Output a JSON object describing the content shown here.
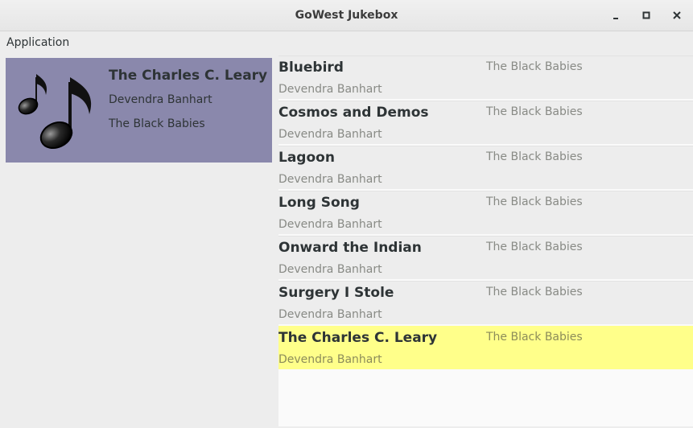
{
  "window": {
    "title": "GoWest Jukebox"
  },
  "menu": {
    "items": [
      "Application"
    ]
  },
  "now_playing": {
    "title": "The Charles C. Leary",
    "artist": "Devendra Banhart",
    "album": "The Black Babies",
    "art_icon": "music-notes-icon",
    "background": "#8a88ac"
  },
  "playlist": {
    "selected_index": 6,
    "selected_color": "#ffff8a",
    "items": [
      {
        "title": "Bluebird",
        "artist": "Devendra Banhart",
        "album": "The Black Babies"
      },
      {
        "title": "Cosmos and Demos",
        "artist": "Devendra Banhart",
        "album": "The Black Babies"
      },
      {
        "title": "Lagoon",
        "artist": "Devendra Banhart",
        "album": "The Black Babies"
      },
      {
        "title": "Long Song",
        "artist": "Devendra Banhart",
        "album": "The Black Babies"
      },
      {
        "title": "Onward the Indian",
        "artist": "Devendra Banhart",
        "album": "The Black Babies"
      },
      {
        "title": "Surgery I Stole",
        "artist": "Devendra Banhart",
        "album": "The Black Babies"
      },
      {
        "title": "The Charles C. Leary",
        "artist": "Devendra Banhart",
        "album": "The Black Babies"
      }
    ]
  }
}
